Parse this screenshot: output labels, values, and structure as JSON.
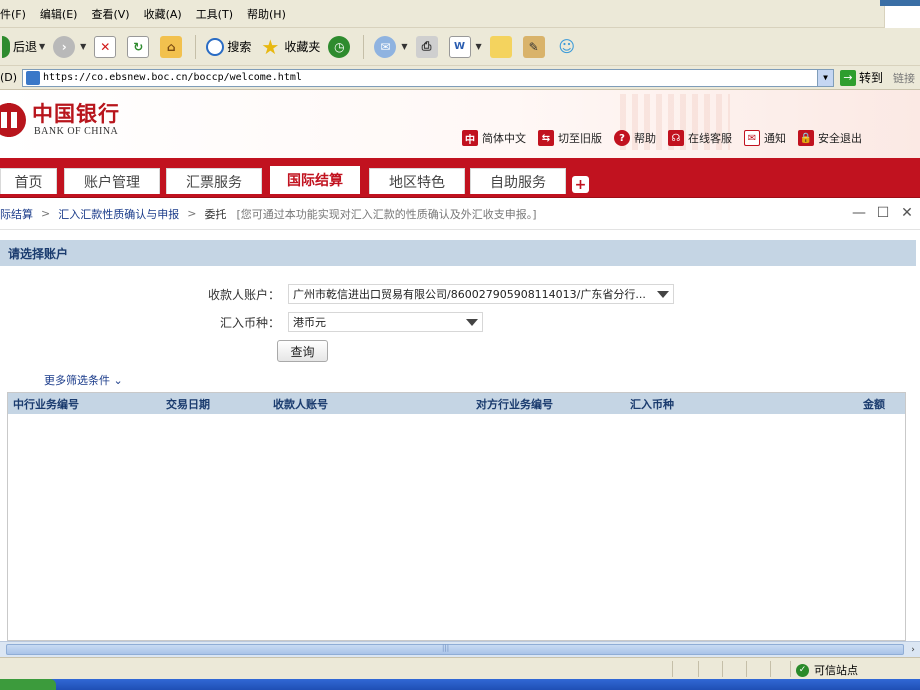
{
  "menu": {
    "items": [
      "件(F)",
      "编辑(E)",
      "查看(V)",
      "收藏(A)",
      "工具(T)",
      "帮助(H)"
    ]
  },
  "toolbar": {
    "back_label": "后退",
    "search_label": "搜索",
    "favorites_label": "收藏夹"
  },
  "address": {
    "label": "(D)",
    "url": "https://co.ebsnew.boc.cn/boccp/welcome.html",
    "go_label": "转到",
    "links_label": "链接"
  },
  "brand": {
    "name_cn": "中国银行",
    "name_en": "BANK OF CHINA"
  },
  "top_links": {
    "lang": "简体中文",
    "old_version": "切至旧版",
    "help": "帮助",
    "service": "在线客服",
    "notice": "通知",
    "logout": "安全退出"
  },
  "nav": {
    "tabs": [
      "首页",
      "账户管理",
      "汇票服务",
      "国际结算",
      "地区特色",
      "自助服务"
    ],
    "active": "国际结算"
  },
  "breadcrumb": {
    "level1": "际结算",
    "level2": "汇入汇款性质确认与申报",
    "level3": "委托",
    "hint": "[您可通过本功能实现对汇入汇款的性质确认及外汇收支申报。]"
  },
  "panel": {
    "title": "请选择账户"
  },
  "form": {
    "account_label": "收款人账户：",
    "account_value": "广州市乾信进出口贸易有限公司/860027905908114013/广东省分行...",
    "currency_label": "汇入币种：",
    "currency_value": "港币元",
    "query_button": "查询",
    "more_filters": "更多筛选条件"
  },
  "table": {
    "columns": [
      "中行业务编号",
      "交易日期",
      "收款人账号",
      "对方行业务编号",
      "汇入币种",
      "金额"
    ]
  },
  "status": {
    "zone": "可信站点"
  },
  "colors": {
    "boc_red": "#c1121f",
    "panel_blue": "#c5d5e4",
    "link_blue": "#1a3b8a"
  }
}
